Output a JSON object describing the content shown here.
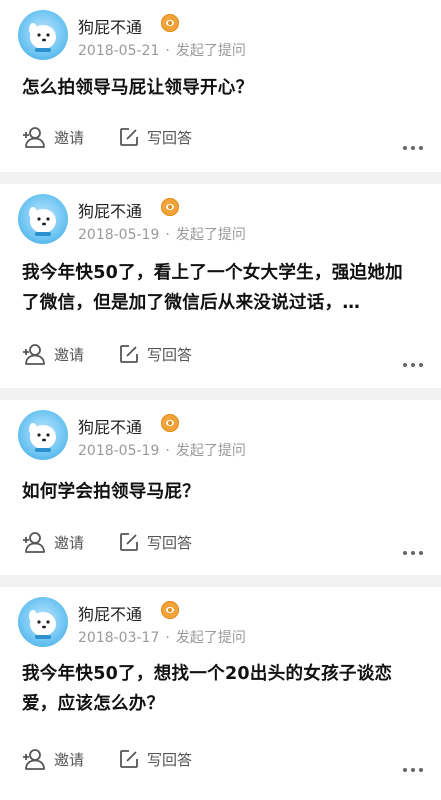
{
  "posts": [
    {
      "user": "狗屁不通",
      "date": "2018-05-21",
      "action": "发起了提问",
      "question": "怎么拍领导马屁让领导开心？"
    },
    {
      "user": "狗屁不通",
      "date": "2018-05-19",
      "action": "发起了提问",
      "question": "我今年快50了，看上了一个女大学生，强迫她加了微信，但是加了微信后从来没说过话，…"
    },
    {
      "user": "狗屁不通",
      "date": "2018-05-19",
      "action": "发起了提问",
      "question": "如何学会拍领导马屁？"
    },
    {
      "user": "狗屁不通",
      "date": "2018-03-17",
      "action": "发起了提问",
      "question": "我今年快50了，想找一个20出头的女孩子谈恋爱，应该怎么办？"
    }
  ],
  "actions": {
    "invite": "邀请",
    "write_answer": "写回答"
  },
  "meta_separator": "·",
  "colors": {
    "background": "#f2f2f2",
    "card": "#ffffff",
    "badge": "#f2a33a",
    "meta_text": "#9a9a9a"
  },
  "icons": [
    "avatar-dog-icon",
    "badge-eye-icon",
    "invite-person-plus-icon",
    "edit-pencil-icon",
    "more-dots-icon"
  ]
}
